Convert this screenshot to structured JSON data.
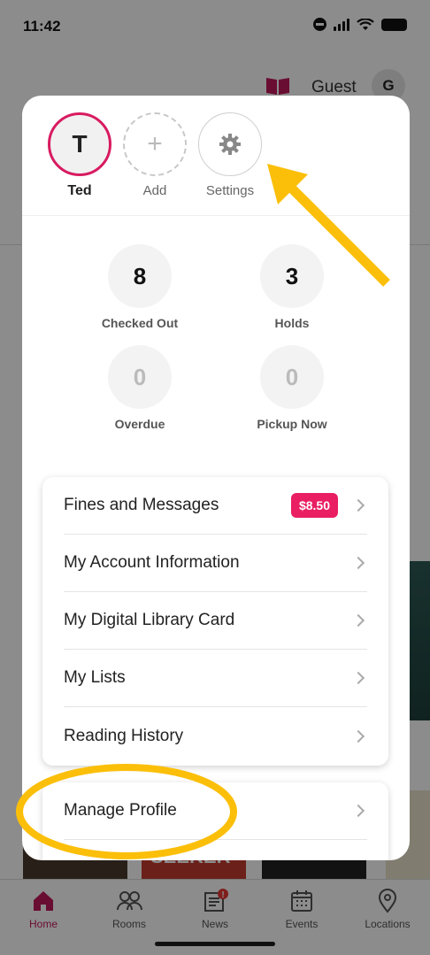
{
  "status_bar": {
    "time": "11:42"
  },
  "top_bar": {
    "user_label": "Guest",
    "avatar_initial": "G"
  },
  "background": {
    "book_title_fragment": "SEEKER"
  },
  "profiles": [
    {
      "initial": "T",
      "label": "Ted",
      "type": "user"
    },
    {
      "initial": "+",
      "label": "Add",
      "type": "add"
    },
    {
      "initial": "",
      "label": "Settings",
      "type": "settings"
    }
  ],
  "stats": [
    {
      "value": "8",
      "label": "Checked Out"
    },
    {
      "value": "3",
      "label": "Holds"
    },
    {
      "value": "0",
      "label": "Overdue"
    },
    {
      "value": "0",
      "label": "Pickup Now"
    }
  ],
  "menu": {
    "fines_label": "Fines and Messages",
    "fines_amount": "$8.50",
    "account_label": "My Account Information",
    "card_label": "My Digital Library Card",
    "lists_label": "My Lists",
    "history_label": "Reading History",
    "manage_label": "Manage Profile"
  },
  "tabs": [
    {
      "label": "Home",
      "icon": "home-icon",
      "active": true
    },
    {
      "label": "Rooms",
      "icon": "people-icon",
      "active": false
    },
    {
      "label": "News",
      "icon": "newspaper-icon",
      "active": false,
      "badge": "!"
    },
    {
      "label": "Events",
      "icon": "calendar-icon",
      "active": false
    },
    {
      "label": "Locations",
      "icon": "location-pin-icon",
      "active": false
    }
  ],
  "colors": {
    "accent": "#d81b60",
    "highlight": "#fbbf0a",
    "badge": "#e91e63"
  }
}
